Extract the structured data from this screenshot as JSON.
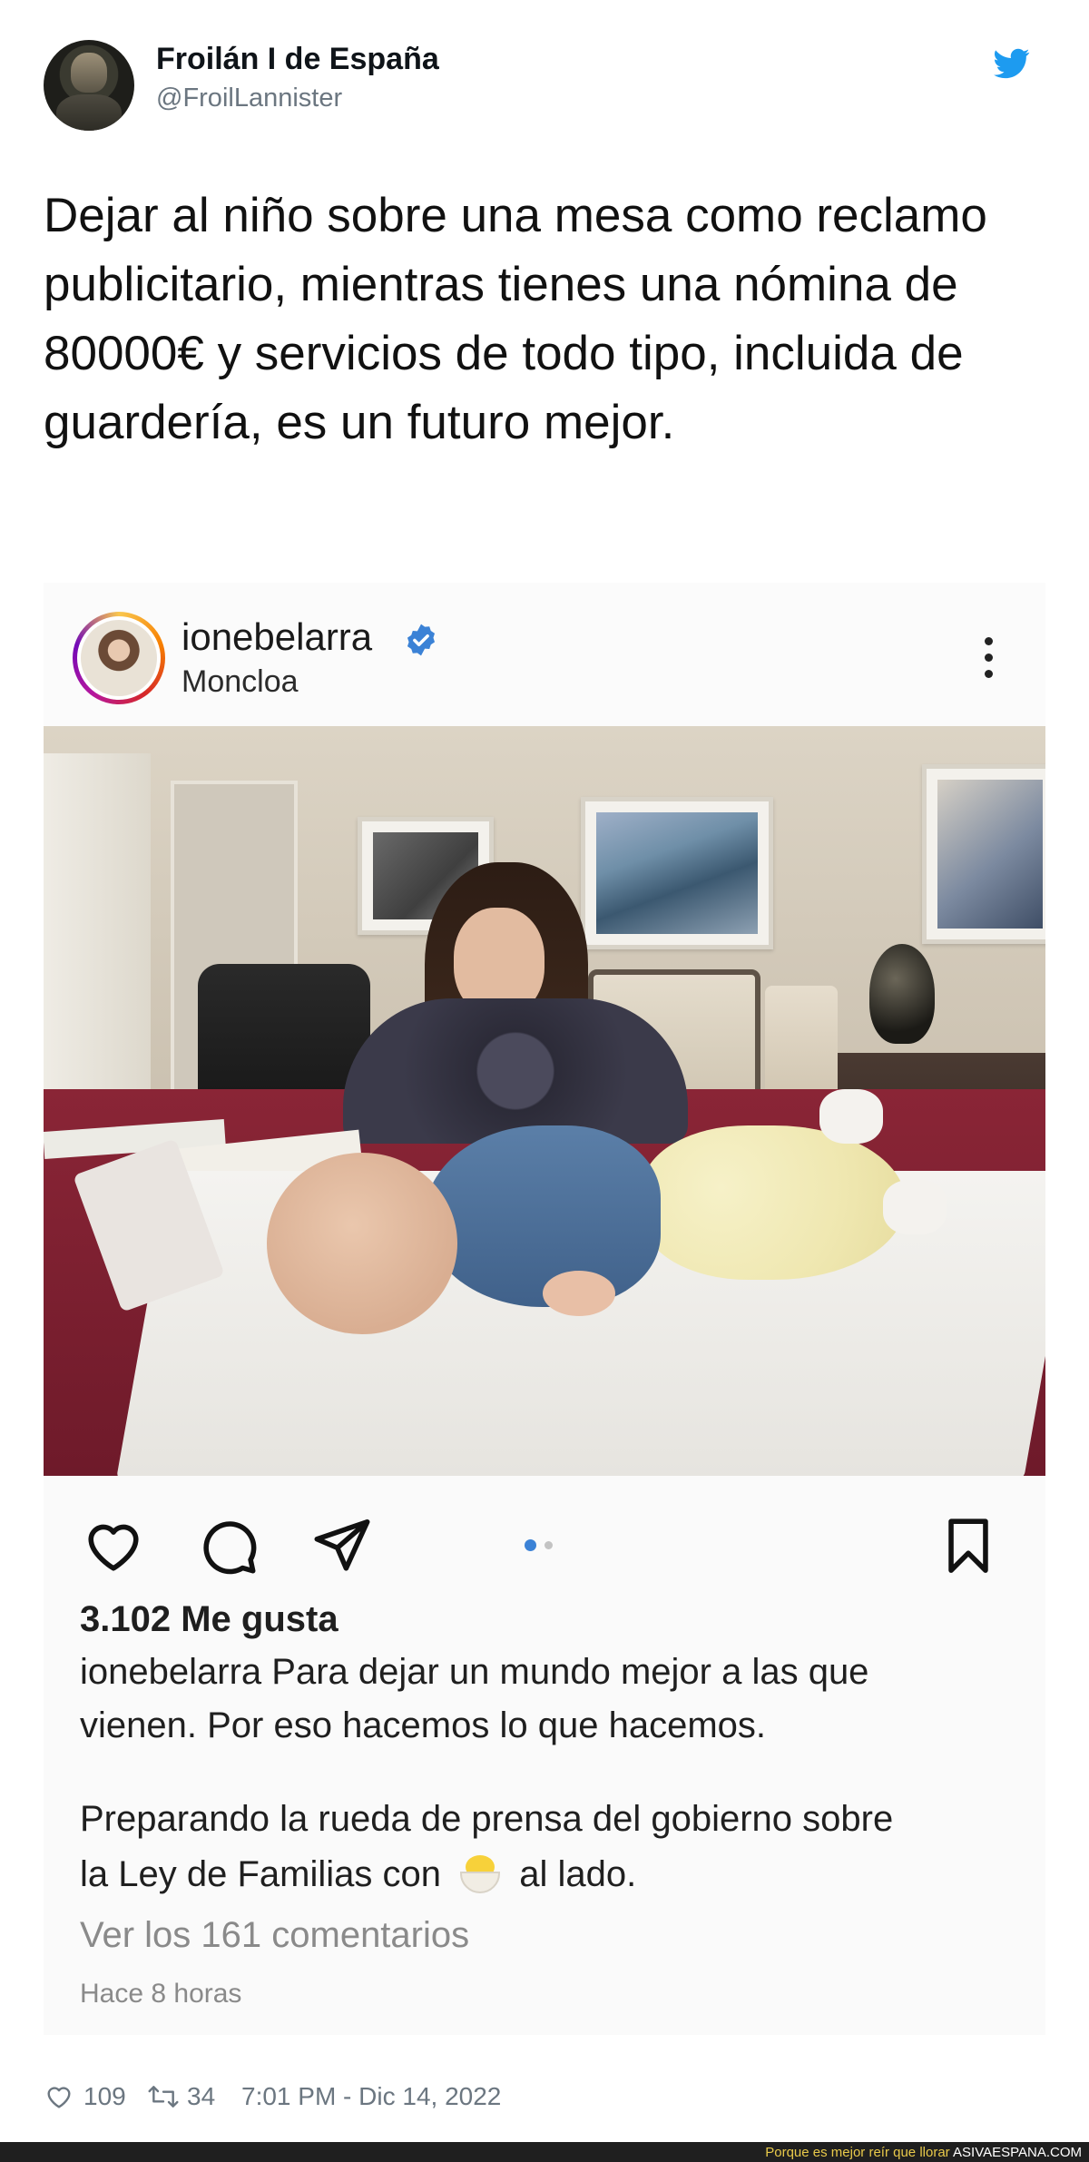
{
  "tweet": {
    "author_name": "Froilán I de España",
    "author_handle": "@FroilLannister",
    "text": "Dejar al niño sobre una mesa como reclamo publicitario, mientras tienes una nómina de 80000€ y servicios de todo tipo, incluida de guardería, es un futuro mejor.",
    "like_count": "109",
    "retweet_count": "34",
    "timestamp": "7:01 PM - Dic 14, 2022",
    "icons": {
      "brand": "twitter-bird-icon",
      "like": "heart-icon",
      "retweet": "retweet-icon"
    },
    "brand_color": "#1d9bf0"
  },
  "instagram": {
    "username": "ionebelarra",
    "location": "Moncloa",
    "likes": "3.102 Me gusta",
    "caption_user": "ionebelarra",
    "caption_line1": "Para dejar un mundo mejor a las que",
    "caption_line2": "vienen. Por eso hacemos lo que hacemos.",
    "caption_line3": "Preparando la rueda de prensa del gobierno sobre",
    "caption_line4_before": "la Ley de Familias con",
    "caption_line4_after": "al lado.",
    "view_comments": "Ver los 161 comentarios",
    "time_ago": "Hace 8 horas",
    "carousel": {
      "current": 1,
      "total": 2
    },
    "icons": [
      "verified-badge-icon",
      "more-options-icon",
      "heart-icon",
      "comment-icon",
      "share-icon",
      "bookmark-icon",
      "hatching-chick-emoji"
    ],
    "accent_color": "#3b82d6"
  },
  "watermark": {
    "tagline": "Porque es mejor reír que llorar",
    "site": "ASIVAESPANA.COM"
  }
}
